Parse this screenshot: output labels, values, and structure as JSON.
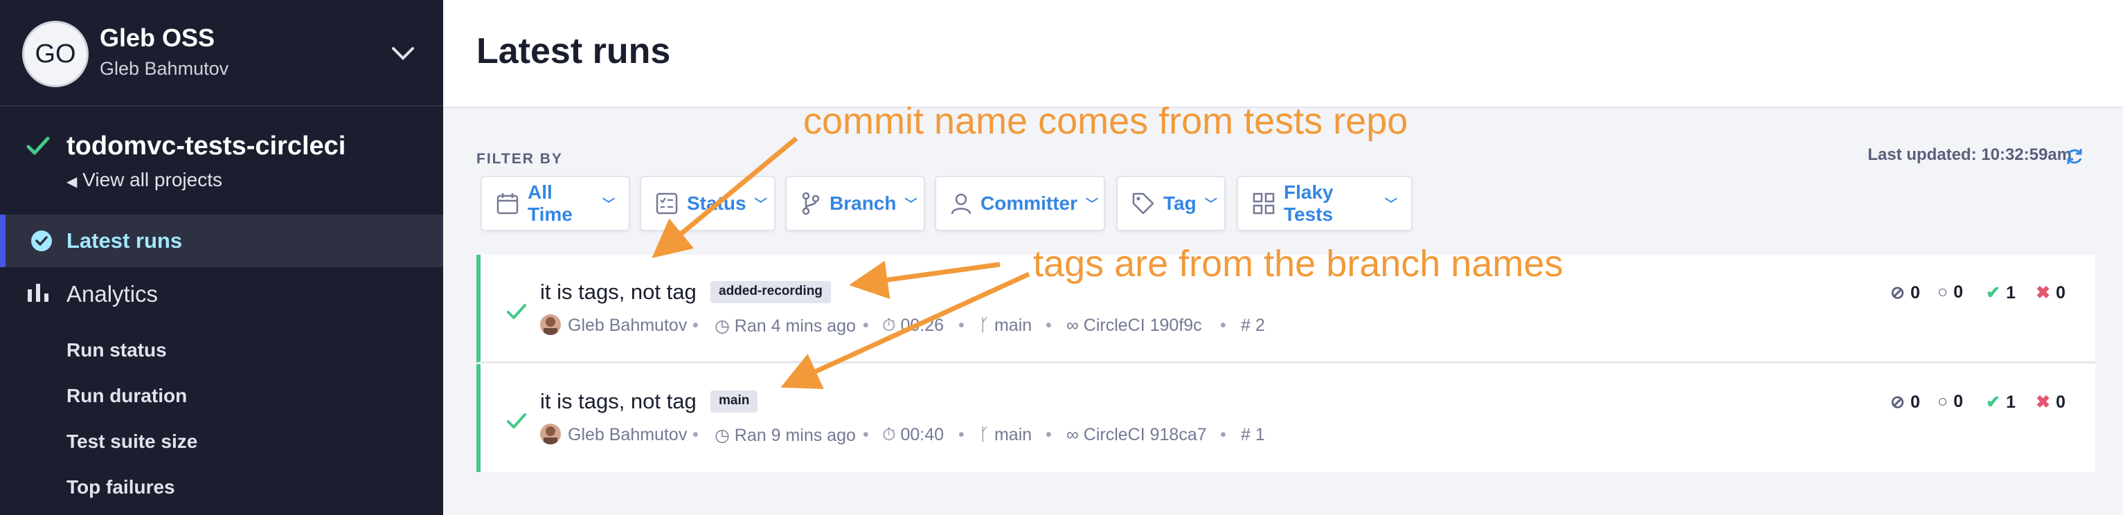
{
  "org": {
    "initials": "GO",
    "name": "Gleb OSS",
    "user": "Gleb Bahmutov"
  },
  "project": {
    "name": "todomvc-tests-circleci",
    "view_all": "View all projects"
  },
  "nav": {
    "latest_runs": "Latest runs",
    "analytics": "Analytics",
    "analytics_items": [
      "Run status",
      "Run duration",
      "Test suite size",
      "Top failures"
    ]
  },
  "page": {
    "title": "Latest runs",
    "filter_by": "FILTER BY",
    "last_updated": "Last updated: 10:32:59am"
  },
  "filters": [
    "All Time",
    "Status",
    "Branch",
    "Committer",
    "Tag",
    "Flaky Tests"
  ],
  "runs": [
    {
      "title": "it is tags, not tag",
      "tag": "added-recording",
      "author": "Gleb Bahmutov",
      "ran": "Ran 4 mins ago",
      "duration": "00:26",
      "branch": "main",
      "ci": "CircleCI 190f9c",
      "number": "2",
      "skipped": "0",
      "pending": "0",
      "passed": "1",
      "failed": "0"
    },
    {
      "title": "it is tags, not tag",
      "tag": "main",
      "author": "Gleb Bahmutov",
      "ran": "Ran 9 mins ago",
      "duration": "00:40",
      "branch": "main",
      "ci": "CircleCI 918ca7",
      "number": "1",
      "skipped": "0",
      "pending": "0",
      "passed": "1",
      "failed": "0"
    }
  ],
  "annotations": {
    "commit_note": "commit name comes from tests repo",
    "tags_note": "tags are from the branch names"
  },
  "colors": {
    "sidebar": "#1b1e2e",
    "accent": "#3486e3",
    "passed": "#46c88a",
    "failed": "#e45770",
    "annotation": "#f29a3a"
  }
}
